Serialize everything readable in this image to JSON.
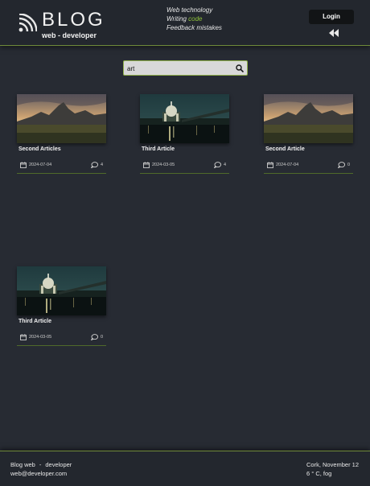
{
  "header": {
    "logo_title": "BLOG",
    "logo_sub": "web - developer",
    "tagline": {
      "line1": "Web technology",
      "line2_prefix": "Writing ",
      "line2_accent": "code",
      "line3": "Feedback mistakes"
    },
    "login_label": "Login",
    "icons": {
      "logo": "wifi-arcs-logo-icon",
      "back": "rewind-icon"
    }
  },
  "search": {
    "value": "art",
    "icon": "search-icon"
  },
  "articles": [
    {
      "title": "Second Articles",
      "date": "2024-07-04",
      "comments": "4",
      "image": "mountain-sunset"
    },
    {
      "title": "Third Article",
      "date": "2024-03-05",
      "comments": "4",
      "image": "city-night-dome"
    },
    {
      "title": "Second Article",
      "date": "2024-07-04",
      "comments": "0",
      "image": "mountain-sunset"
    },
    {
      "title": "Third Article",
      "date": "2024-03-05",
      "comments": "0",
      "image": "city-night-dome"
    }
  ],
  "footer": {
    "left_line1_a": "Blog web",
    "left_line1_sep": "-",
    "left_line1_b": "developer",
    "left_line2": "web@developer.com",
    "right_line1": "Cork, November 12",
    "right_line2": "6 ° C, fog"
  },
  "colors": {
    "background": "#272b33",
    "header": "#23272e",
    "accent": "#8fc23a",
    "rule": "#4f6a2a"
  }
}
